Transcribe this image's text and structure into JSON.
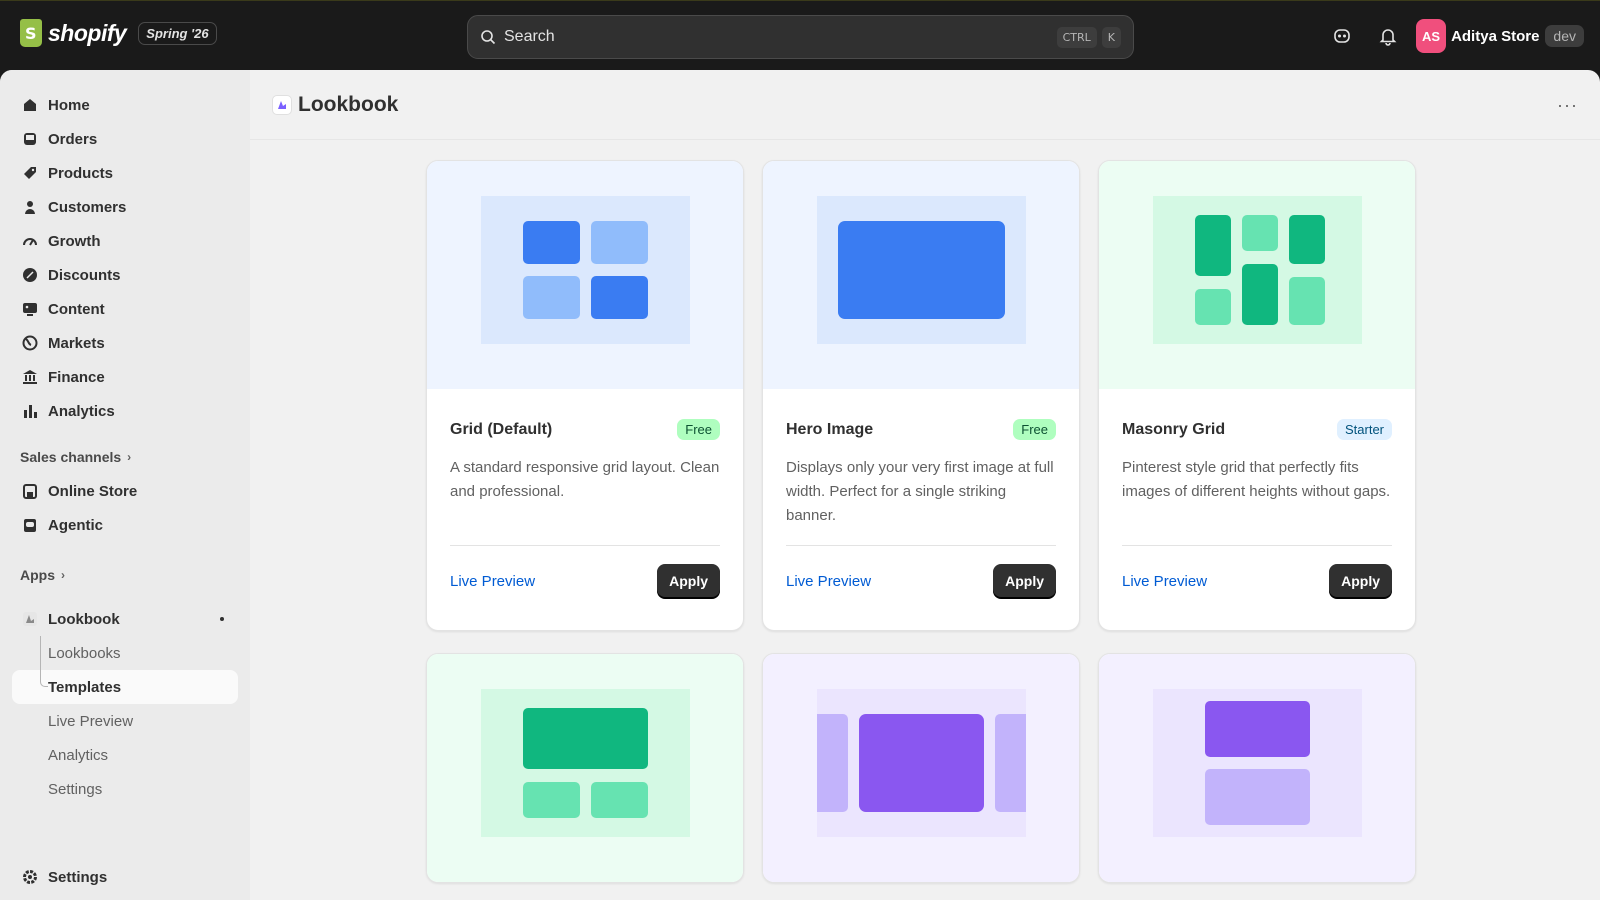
{
  "topbar": {
    "logo_text": "shopify",
    "edition": "Spring '26",
    "search_placeholder": "Search",
    "kbd_ctrl": "CTRL",
    "kbd_k": "K",
    "avatar_initials": "AS",
    "store_name": "Aditya Store",
    "env_badge": "dev"
  },
  "sidebar": {
    "items": [
      {
        "label": "Home",
        "icon": "home-icon"
      },
      {
        "label": "Orders",
        "icon": "inbox-icon"
      },
      {
        "label": "Products",
        "icon": "tag-icon"
      },
      {
        "label": "Customers",
        "icon": "person-icon"
      },
      {
        "label": "Growth",
        "icon": "gauge-icon"
      },
      {
        "label": "Discounts",
        "icon": "discount-icon"
      },
      {
        "label": "Content",
        "icon": "image-icon"
      },
      {
        "label": "Markets",
        "icon": "globe-icon"
      },
      {
        "label": "Finance",
        "icon": "bank-icon"
      },
      {
        "label": "Analytics",
        "icon": "bar-chart-icon"
      }
    ],
    "sales_channels_label": "Sales channels",
    "sales_channels": [
      {
        "label": "Online Store",
        "icon": "store-icon"
      },
      {
        "label": "Agentic",
        "icon": "robot-icon"
      }
    ],
    "apps_label": "Apps",
    "app": {
      "label": "Lookbook",
      "subitems": [
        "Lookbooks",
        "Templates",
        "Live Preview",
        "Analytics",
        "Settings"
      ],
      "active": "Templates"
    },
    "settings_label": "Settings"
  },
  "page": {
    "title": "Lookbook",
    "more_label": "···"
  },
  "templates": [
    {
      "title": "Grid (Default)",
      "badge": "Free",
      "badge_type": "free",
      "description": "A standard responsive grid layout. Clean and professional.",
      "preview_label": "Live Preview",
      "apply_label": "Apply",
      "preview_bg": "#eef4ff",
      "art_bg": "#dbe8fd"
    },
    {
      "title": "Hero Image",
      "badge": "Free",
      "badge_type": "free",
      "description": "Displays only your very first image at full width. Perfect for a single striking banner.",
      "preview_label": "Live Preview",
      "apply_label": "Apply",
      "preview_bg": "#eef4ff",
      "art_bg": "#dbe8fd"
    },
    {
      "title": "Masonry Grid",
      "badge": "Starter",
      "badge_type": "starter",
      "description": "Pinterest style grid that perfectly fits images of different heights without gaps.",
      "preview_label": "Live Preview",
      "apply_label": "Apply",
      "preview_bg": "#ecfdf3",
      "art_bg": "#d4f9e4"
    },
    {
      "preview_bg": "#ecfdf3",
      "art_bg": "#d4f9e4"
    },
    {
      "preview_bg": "#f3f0ff",
      "art_bg": "#ebe5fe"
    },
    {
      "preview_bg": "#f3f0ff",
      "art_bg": "#ebe5fe"
    }
  ],
  "colors": {
    "blue_dark": "#3a7cf2",
    "blue_light": "#90bcfb",
    "green_dark": "#10b77f",
    "green_light": "#66e3b1",
    "purple_dark": "#8a57f0",
    "purple_light": "#c2b3fb"
  }
}
